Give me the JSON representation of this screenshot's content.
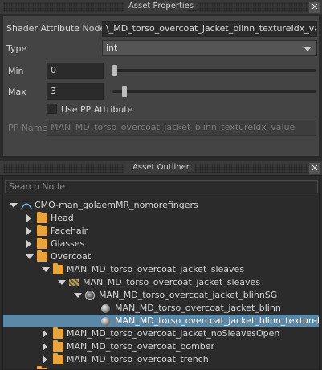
{
  "asset_properties": {
    "title": "Asset Properties",
    "close_glyph": "✕",
    "shader_attribute_node": {
      "label": "Shader Attribute Node",
      "value": "MAN_MD_torso_overcoat_jacket_blinn_textureIdx_value",
      "shown": "\\_MD_torso_overcoat_jacket_blinn_textureIdx_value"
    },
    "type": {
      "label": "Type",
      "value": "int"
    },
    "min": {
      "label": "Min",
      "value": "0",
      "level": 0.0
    },
    "max": {
      "label": "Max",
      "value": "3",
      "level": 0.03
    },
    "use_pp": {
      "label": "Use PP Attribute",
      "checked": false
    },
    "pp_name": {
      "label": "PP Name",
      "value": "MAN_MD_torso_overcoat_jacket_blinn_textureIdx_value"
    }
  },
  "asset_outliner": {
    "title": "Asset Outliner",
    "search_placeholder": "Search Node",
    "tree": [
      {
        "label": "CMO-man_golaemMR_nomorefingers",
        "depth": 0,
        "expanded": true,
        "icon": "crowd-icon"
      },
      {
        "label": "Head",
        "depth": 1,
        "expanded": false,
        "icon": "folder-icon"
      },
      {
        "label": "Facehair",
        "depth": 1,
        "expanded": false,
        "icon": "folder-icon"
      },
      {
        "label": "Glasses",
        "depth": 1,
        "expanded": false,
        "icon": "folder-icon"
      },
      {
        "label": "Overcoat",
        "depth": 1,
        "expanded": true,
        "icon": "folder-icon"
      },
      {
        "label": "MAN_MD_torso_overcoat_jacket_sleaves",
        "depth": 2,
        "expanded": true,
        "icon": "folder-icon"
      },
      {
        "label": "MAN_MD_torso_overcoat_jacket_sleaves",
        "depth": 3,
        "expanded": true,
        "icon": "mesh-icon"
      },
      {
        "label": "MAN_MD_torso_overcoat_jacket_blinnSG",
        "depth": 4,
        "expanded": true,
        "icon": "shading-group-icon"
      },
      {
        "label": "MAN_MD_torso_overcoat_jacket_blinn",
        "depth": 5,
        "expanded": null,
        "icon": "material-ball-icon"
      },
      {
        "label": "MAN_MD_torso_overcoat_jacket_blinn_texturel...",
        "depth": 5,
        "expanded": null,
        "icon": "material-ball-icon",
        "selected": true
      },
      {
        "label": "MAN_MD_torso_overcoat_jacket_noSleavesOpen",
        "depth": 2,
        "expanded": false,
        "icon": "folder-icon"
      },
      {
        "label": "MAN_MD_torso_overcoat_bomber",
        "depth": 2,
        "expanded": false,
        "icon": "folder-icon"
      },
      {
        "label": "MAN_MD_torso_overcoat_trench",
        "depth": 2,
        "expanded": false,
        "icon": "folder-icon"
      },
      {
        "label": "",
        "depth": 1,
        "expanded": true,
        "icon": "folder-icon"
      }
    ]
  }
}
